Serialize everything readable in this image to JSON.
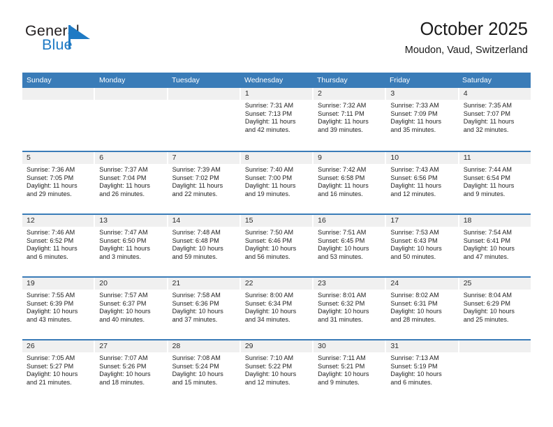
{
  "brand": {
    "name_top": "General",
    "name_bottom": "Blue",
    "mark": "triangle-flag-logo",
    "color_text": "#231f20",
    "color_blue": "#1f7ac4"
  },
  "header": {
    "title": "October 2025",
    "subtitle": "Moudon, Vaud, Switzerland"
  },
  "theme": {
    "header_blue": "#3a7cb8",
    "daynum_gray": "#f0f0f0",
    "text": "#222222"
  },
  "calendar": {
    "weekday_headers": [
      "Sunday",
      "Monday",
      "Tuesday",
      "Wednesday",
      "Thursday",
      "Friday",
      "Saturday"
    ],
    "weeks": [
      [
        {
          "day": "",
          "empty": true,
          "sunrise": "",
          "sunset": "",
          "daylight_1": "",
          "daylight_2": ""
        },
        {
          "day": "",
          "empty": true,
          "sunrise": "",
          "sunset": "",
          "daylight_1": "",
          "daylight_2": ""
        },
        {
          "day": "",
          "empty": true,
          "sunrise": "",
          "sunset": "",
          "daylight_1": "",
          "daylight_2": ""
        },
        {
          "day": "1",
          "empty": false,
          "sunrise": "Sunrise: 7:31 AM",
          "sunset": "Sunset: 7:13 PM",
          "daylight_1": "Daylight: 11 hours",
          "daylight_2": "and 42 minutes."
        },
        {
          "day": "2",
          "empty": false,
          "sunrise": "Sunrise: 7:32 AM",
          "sunset": "Sunset: 7:11 PM",
          "daylight_1": "Daylight: 11 hours",
          "daylight_2": "and 39 minutes."
        },
        {
          "day": "3",
          "empty": false,
          "sunrise": "Sunrise: 7:33 AM",
          "sunset": "Sunset: 7:09 PM",
          "daylight_1": "Daylight: 11 hours",
          "daylight_2": "and 35 minutes."
        },
        {
          "day": "4",
          "empty": false,
          "sunrise": "Sunrise: 7:35 AM",
          "sunset": "Sunset: 7:07 PM",
          "daylight_1": "Daylight: 11 hours",
          "daylight_2": "and 32 minutes."
        }
      ],
      [
        {
          "day": "5",
          "empty": false,
          "sunrise": "Sunrise: 7:36 AM",
          "sunset": "Sunset: 7:05 PM",
          "daylight_1": "Daylight: 11 hours",
          "daylight_2": "and 29 minutes."
        },
        {
          "day": "6",
          "empty": false,
          "sunrise": "Sunrise: 7:37 AM",
          "sunset": "Sunset: 7:04 PM",
          "daylight_1": "Daylight: 11 hours",
          "daylight_2": "and 26 minutes."
        },
        {
          "day": "7",
          "empty": false,
          "sunrise": "Sunrise: 7:39 AM",
          "sunset": "Sunset: 7:02 PM",
          "daylight_1": "Daylight: 11 hours",
          "daylight_2": "and 22 minutes."
        },
        {
          "day": "8",
          "empty": false,
          "sunrise": "Sunrise: 7:40 AM",
          "sunset": "Sunset: 7:00 PM",
          "daylight_1": "Daylight: 11 hours",
          "daylight_2": "and 19 minutes."
        },
        {
          "day": "9",
          "empty": false,
          "sunrise": "Sunrise: 7:42 AM",
          "sunset": "Sunset: 6:58 PM",
          "daylight_1": "Daylight: 11 hours",
          "daylight_2": "and 16 minutes."
        },
        {
          "day": "10",
          "empty": false,
          "sunrise": "Sunrise: 7:43 AM",
          "sunset": "Sunset: 6:56 PM",
          "daylight_1": "Daylight: 11 hours",
          "daylight_2": "and 12 minutes."
        },
        {
          "day": "11",
          "empty": false,
          "sunrise": "Sunrise: 7:44 AM",
          "sunset": "Sunset: 6:54 PM",
          "daylight_1": "Daylight: 11 hours",
          "daylight_2": "and 9 minutes."
        }
      ],
      [
        {
          "day": "12",
          "empty": false,
          "sunrise": "Sunrise: 7:46 AM",
          "sunset": "Sunset: 6:52 PM",
          "daylight_1": "Daylight: 11 hours",
          "daylight_2": "and 6 minutes."
        },
        {
          "day": "13",
          "empty": false,
          "sunrise": "Sunrise: 7:47 AM",
          "sunset": "Sunset: 6:50 PM",
          "daylight_1": "Daylight: 11 hours",
          "daylight_2": "and 3 minutes."
        },
        {
          "day": "14",
          "empty": false,
          "sunrise": "Sunrise: 7:48 AM",
          "sunset": "Sunset: 6:48 PM",
          "daylight_1": "Daylight: 10 hours",
          "daylight_2": "and 59 minutes."
        },
        {
          "day": "15",
          "empty": false,
          "sunrise": "Sunrise: 7:50 AM",
          "sunset": "Sunset: 6:46 PM",
          "daylight_1": "Daylight: 10 hours",
          "daylight_2": "and 56 minutes."
        },
        {
          "day": "16",
          "empty": false,
          "sunrise": "Sunrise: 7:51 AM",
          "sunset": "Sunset: 6:45 PM",
          "daylight_1": "Daylight: 10 hours",
          "daylight_2": "and 53 minutes."
        },
        {
          "day": "17",
          "empty": false,
          "sunrise": "Sunrise: 7:53 AM",
          "sunset": "Sunset: 6:43 PM",
          "daylight_1": "Daylight: 10 hours",
          "daylight_2": "and 50 minutes."
        },
        {
          "day": "18",
          "empty": false,
          "sunrise": "Sunrise: 7:54 AM",
          "sunset": "Sunset: 6:41 PM",
          "daylight_1": "Daylight: 10 hours",
          "daylight_2": "and 47 minutes."
        }
      ],
      [
        {
          "day": "19",
          "empty": false,
          "sunrise": "Sunrise: 7:55 AM",
          "sunset": "Sunset: 6:39 PM",
          "daylight_1": "Daylight: 10 hours",
          "daylight_2": "and 43 minutes."
        },
        {
          "day": "20",
          "empty": false,
          "sunrise": "Sunrise: 7:57 AM",
          "sunset": "Sunset: 6:37 PM",
          "daylight_1": "Daylight: 10 hours",
          "daylight_2": "and 40 minutes."
        },
        {
          "day": "21",
          "empty": false,
          "sunrise": "Sunrise: 7:58 AM",
          "sunset": "Sunset: 6:36 PM",
          "daylight_1": "Daylight: 10 hours",
          "daylight_2": "and 37 minutes."
        },
        {
          "day": "22",
          "empty": false,
          "sunrise": "Sunrise: 8:00 AM",
          "sunset": "Sunset: 6:34 PM",
          "daylight_1": "Daylight: 10 hours",
          "daylight_2": "and 34 minutes."
        },
        {
          "day": "23",
          "empty": false,
          "sunrise": "Sunrise: 8:01 AM",
          "sunset": "Sunset: 6:32 PM",
          "daylight_1": "Daylight: 10 hours",
          "daylight_2": "and 31 minutes."
        },
        {
          "day": "24",
          "empty": false,
          "sunrise": "Sunrise: 8:02 AM",
          "sunset": "Sunset: 6:31 PM",
          "daylight_1": "Daylight: 10 hours",
          "daylight_2": "and 28 minutes."
        },
        {
          "day": "25",
          "empty": false,
          "sunrise": "Sunrise: 8:04 AM",
          "sunset": "Sunset: 6:29 PM",
          "daylight_1": "Daylight: 10 hours",
          "daylight_2": "and 25 minutes."
        }
      ],
      [
        {
          "day": "26",
          "empty": false,
          "sunrise": "Sunrise: 7:05 AM",
          "sunset": "Sunset: 5:27 PM",
          "daylight_1": "Daylight: 10 hours",
          "daylight_2": "and 21 minutes."
        },
        {
          "day": "27",
          "empty": false,
          "sunrise": "Sunrise: 7:07 AM",
          "sunset": "Sunset: 5:26 PM",
          "daylight_1": "Daylight: 10 hours",
          "daylight_2": "and 18 minutes."
        },
        {
          "day": "28",
          "empty": false,
          "sunrise": "Sunrise: 7:08 AM",
          "sunset": "Sunset: 5:24 PM",
          "daylight_1": "Daylight: 10 hours",
          "daylight_2": "and 15 minutes."
        },
        {
          "day": "29",
          "empty": false,
          "sunrise": "Sunrise: 7:10 AM",
          "sunset": "Sunset: 5:22 PM",
          "daylight_1": "Daylight: 10 hours",
          "daylight_2": "and 12 minutes."
        },
        {
          "day": "30",
          "empty": false,
          "sunrise": "Sunrise: 7:11 AM",
          "sunset": "Sunset: 5:21 PM",
          "daylight_1": "Daylight: 10 hours",
          "daylight_2": "and 9 minutes."
        },
        {
          "day": "31",
          "empty": false,
          "sunrise": "Sunrise: 7:13 AM",
          "sunset": "Sunset: 5:19 PM",
          "daylight_1": "Daylight: 10 hours",
          "daylight_2": "and 6 minutes."
        },
        {
          "day": "",
          "empty": true,
          "sunrise": "",
          "sunset": "",
          "daylight_1": "",
          "daylight_2": ""
        }
      ]
    ]
  }
}
